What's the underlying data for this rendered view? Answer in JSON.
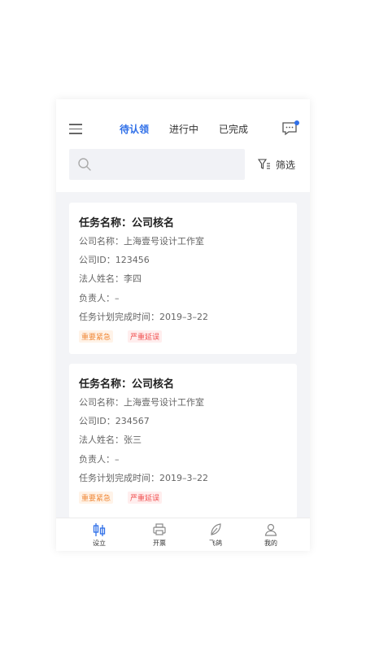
{
  "header": {
    "tabs": [
      {
        "label": "待认领",
        "active": true
      },
      {
        "label": "进行中",
        "active": false
      },
      {
        "label": "已完成",
        "active": false
      }
    ],
    "search": {
      "placeholder": ""
    },
    "filter_label": "筛选"
  },
  "tasks": [
    {
      "title": "任务名称：公司核名",
      "company": "公司名称：上海壹号设计工作室",
      "company_id": "公司ID：123456",
      "legal_person": "法人姓名：李四",
      "owner": "负责人：–",
      "deadline": "任务计划完成时间：2019–3–22",
      "tags": [
        "重要紧急",
        "严重延误"
      ]
    },
    {
      "title": "任务名称：公司核名",
      "company": "公司名称：上海壹号设计工作室",
      "company_id": "公司ID：234567",
      "legal_person": "法人姓名：张三",
      "owner": "负责人：–",
      "deadline": "任务计划完成时间：2019–3–22",
      "tags": [
        "重要紧急",
        "严重延误"
      ]
    }
  ],
  "tabbar": {
    "items": [
      {
        "label": "设立",
        "icon": "establish-icon",
        "active": true
      },
      {
        "label": "开票",
        "icon": "printer-icon",
        "active": false
      },
      {
        "label": "飞鸽",
        "icon": "feather-icon",
        "active": false
      },
      {
        "label": "我的",
        "icon": "user-icon",
        "active": false
      }
    ]
  },
  "colors": {
    "accent": "#2f6fe8",
    "urgent": "#f08a3a",
    "delay": "#f05050",
    "background": "#f3f4f7"
  }
}
